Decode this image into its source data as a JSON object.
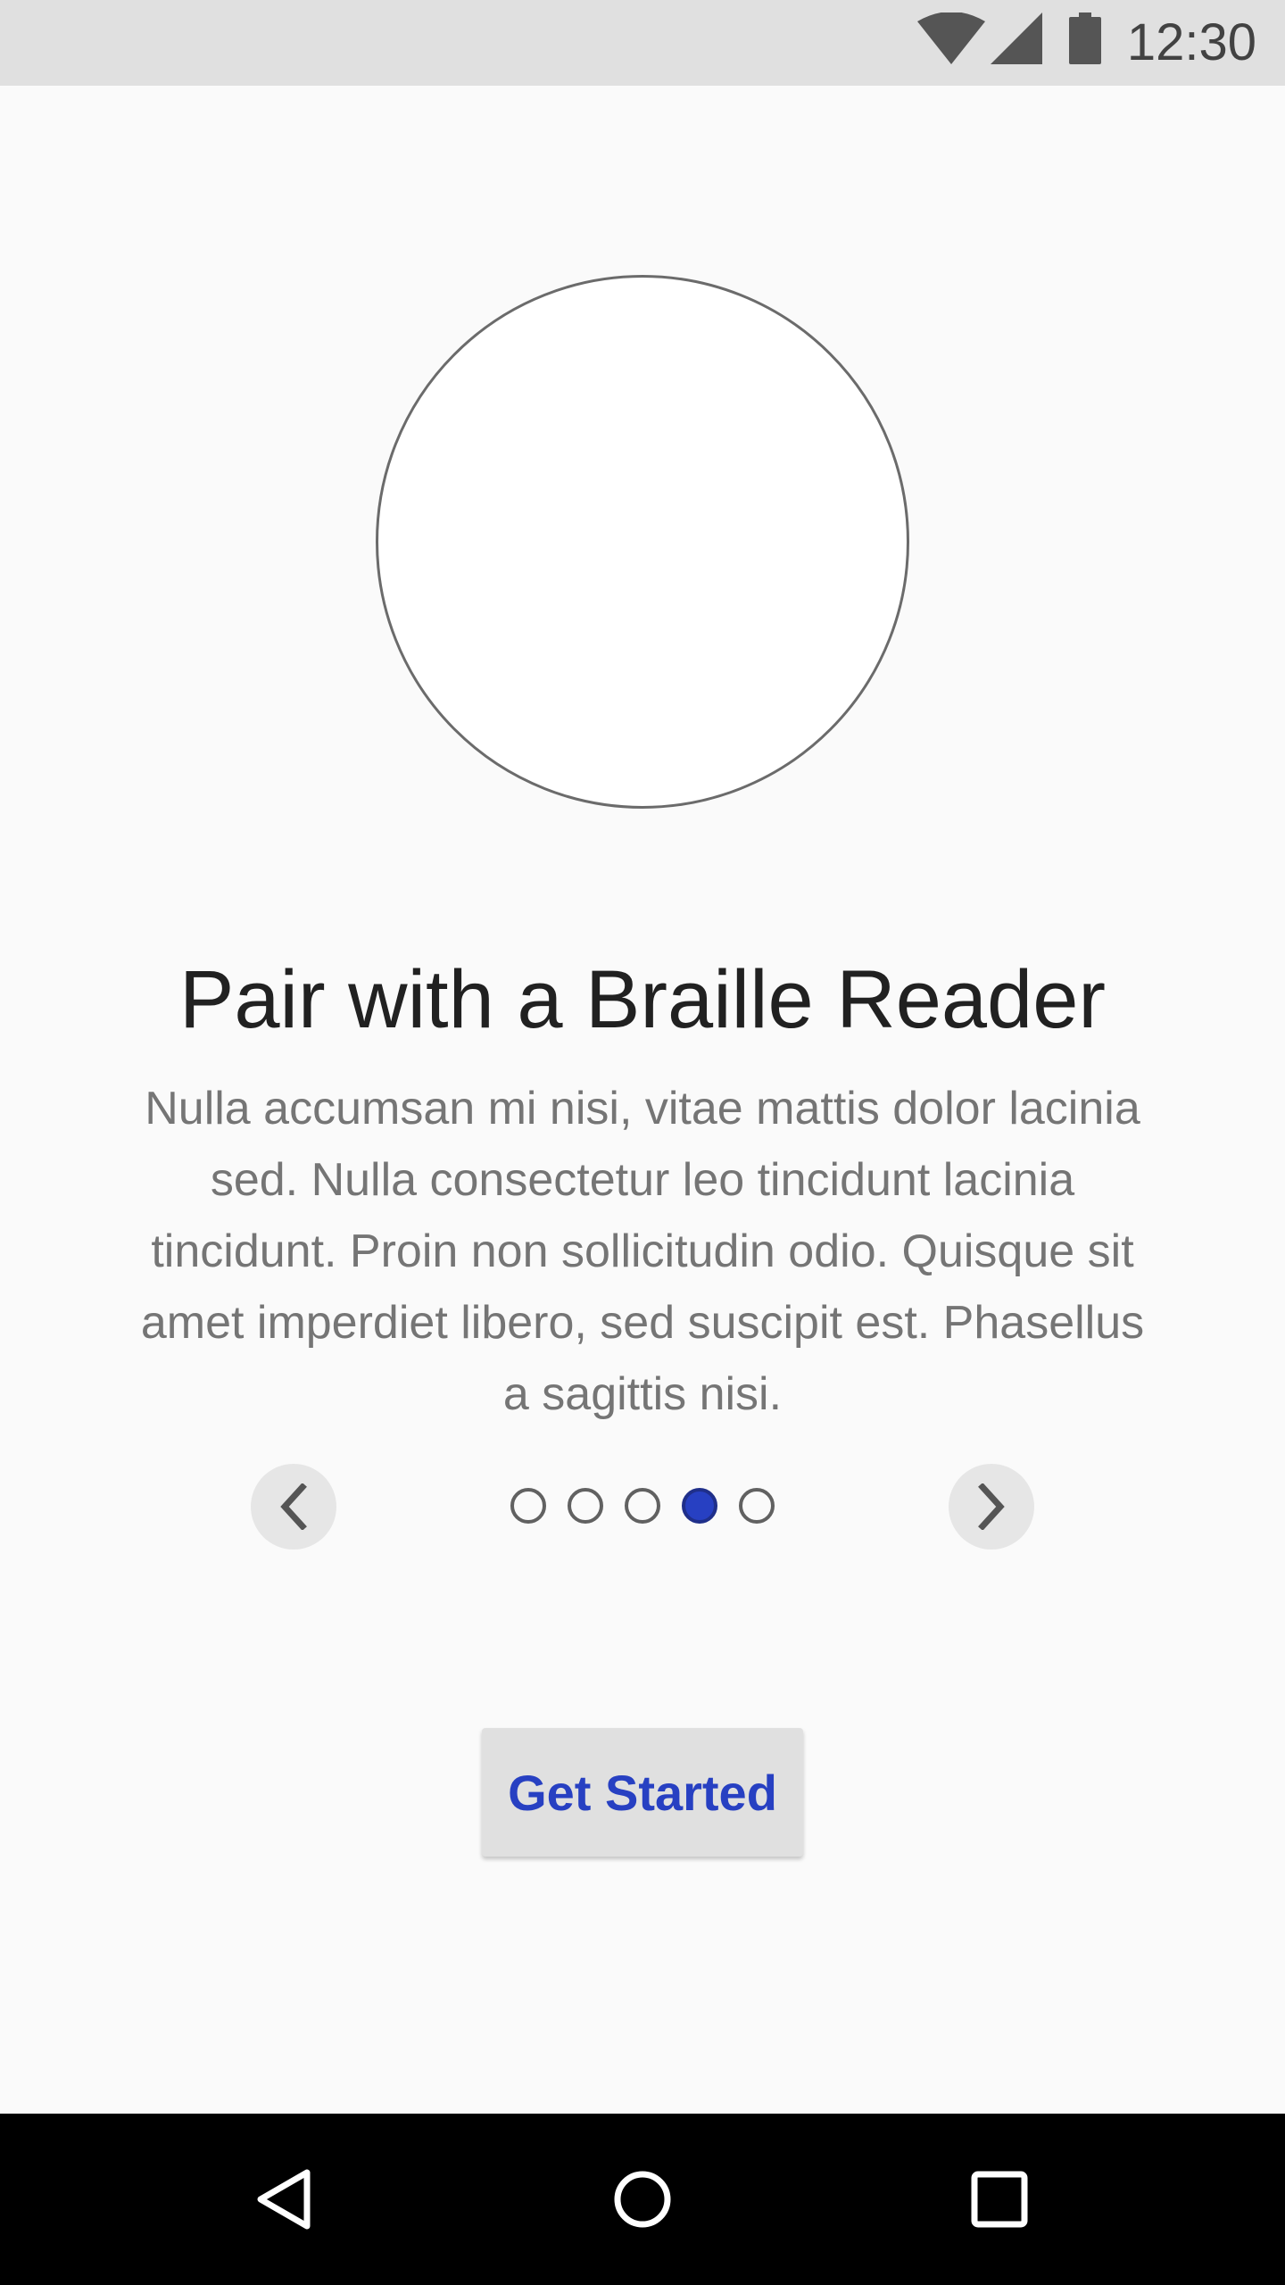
{
  "status_bar": {
    "time": "12:30",
    "icons": [
      "wifi-icon",
      "cellular-signal-icon",
      "battery-icon"
    ]
  },
  "onboarding": {
    "title": "Pair with a Braille Reader",
    "body": "Nulla accumsan mi nisi, vitae mattis dolor lacinia sed. Nulla consectetur leo tincidunt lacinia tincidunt. Proin non sollicitudin odio. Quisque sit amet imperdiet libero, sed suscipit est. Phasellus a sagittis nisi.",
    "page_count": 5,
    "current_page": 4,
    "prev_icon": "chevron-left-icon",
    "next_icon": "chevron-right-icon"
  },
  "cta": {
    "label": "Get Started"
  },
  "nav_bar": {
    "buttons": [
      "back-icon",
      "home-icon",
      "recents-icon"
    ]
  },
  "colors": {
    "accent": "#2740c2",
    "status_bar": "#e0e0e0",
    "background": "#fafafa",
    "nav_bar": "#000000"
  }
}
